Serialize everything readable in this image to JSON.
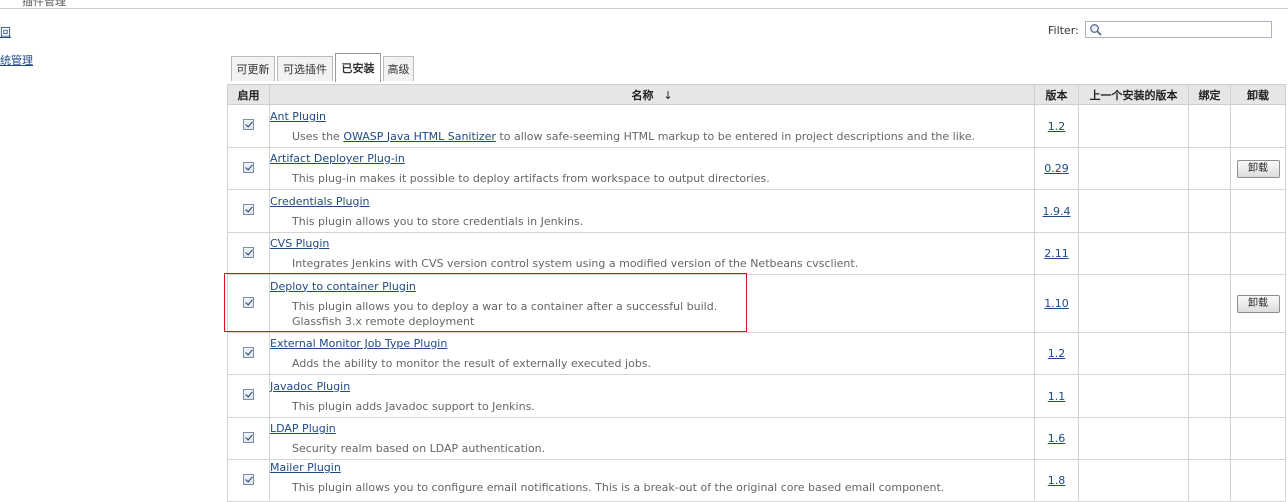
{
  "breadcrumb": {
    "current": "插件管理"
  },
  "sidebar": {
    "items": [
      {
        "label": "回"
      },
      {
        "label": "统管理"
      }
    ]
  },
  "filter": {
    "label": "Filter:",
    "value": ""
  },
  "tabs": [
    {
      "label": "可更新",
      "active": false
    },
    {
      "label": "可选插件",
      "active": false
    },
    {
      "label": "已安装",
      "active": true
    },
    {
      "label": "高级",
      "active": false
    }
  ],
  "table": {
    "headers": {
      "enabled": "启用",
      "name": "名称",
      "sort_arrow": "↓",
      "version": "版本",
      "previous_version": "上一个安装的版本",
      "pinned": "绑定",
      "uninstall": "卸载"
    },
    "uninstall_label": "卸载",
    "rows": [
      {
        "name": "Ant Plugin",
        "desc_pre": "Uses the ",
        "desc_link": "OWASP Java HTML Sanitizer",
        "desc_post": " to allow safe-seeming HTML markup to be entered in project descriptions and the like.",
        "desc2": "",
        "version": "1.2",
        "enabled": true,
        "uninstall": false
      },
      {
        "name": "Artifact Deployer Plug-in",
        "desc_pre": "This plug-in makes it possible to deploy artifacts from workspace to output directories.",
        "desc_link": "",
        "desc_post": "",
        "desc2": "",
        "version": "0.29",
        "enabled": true,
        "uninstall": true
      },
      {
        "name": "Credentials Plugin",
        "desc_pre": "This plugin allows you to store credentials in Jenkins.",
        "desc_link": "",
        "desc_post": "",
        "desc2": "",
        "version": "1.9.4",
        "enabled": true,
        "uninstall": false
      },
      {
        "name": "CVS Plugin",
        "desc_pre": "Integrates Jenkins with CVS version control system using a modified version of the Netbeans cvsclient.",
        "desc_link": "",
        "desc_post": "",
        "desc2": "",
        "version": "2.11",
        "enabled": true,
        "uninstall": false
      },
      {
        "name": "Deploy to container Plugin",
        "desc_pre": "This plugin allows you to deploy a war to a container after a successful build.",
        "desc_link": "",
        "desc_post": "",
        "desc2": "Glassfish 3.x remote deployment",
        "version": "1.10",
        "enabled": true,
        "uninstall": true
      },
      {
        "name": "External Monitor Job Type Plugin",
        "desc_pre": "Adds the ability to monitor the result of externally executed jobs.",
        "desc_link": "",
        "desc_post": "",
        "desc2": "",
        "version": "1.2",
        "enabled": true,
        "uninstall": false
      },
      {
        "name": "Javadoc Plugin",
        "desc_pre": "This plugin adds Javadoc support to Jenkins.",
        "desc_link": "",
        "desc_post": "",
        "desc2": "",
        "version": "1.1",
        "enabled": true,
        "uninstall": false
      },
      {
        "name": "LDAP Plugin",
        "desc_pre": "Security realm based on LDAP authentication.",
        "desc_link": "",
        "desc_post": "",
        "desc2": "",
        "version": "1.6",
        "enabled": true,
        "uninstall": false
      },
      {
        "name": "Mailer Plugin",
        "desc_pre": "This plugin allows you to configure email notifications. This is a break-out of the original core based email component.",
        "desc_link": "",
        "desc_post": "",
        "desc2": "",
        "version": "1.8",
        "enabled": true,
        "uninstall": false
      }
    ]
  },
  "colors": {
    "link": "#204a87",
    "highlight_border": "#d9141c",
    "header_bg": "#e6e6e6"
  }
}
